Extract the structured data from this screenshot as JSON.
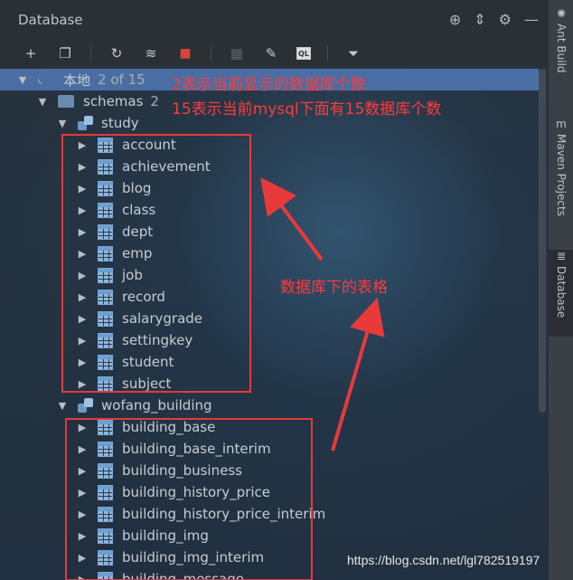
{
  "panel": {
    "title": "Database"
  },
  "title_tools": [
    "globe-icon",
    "collapse-icon",
    "gear-icon",
    "minimize-icon"
  ],
  "toolbar": [
    "add",
    "copy",
    "refresh",
    "edit-schema",
    "stop",
    "table",
    "pencil",
    "console",
    "filter"
  ],
  "tree": {
    "root": {
      "label": "本地",
      "count": "2 of 15"
    },
    "schemas": {
      "label": "schemas",
      "count": "2"
    },
    "study": {
      "label": "study",
      "tables": [
        "account",
        "achievement",
        "blog",
        "class",
        "dept",
        "emp",
        "job",
        "record",
        "salarygrade",
        "settingkey",
        "student",
        "subject"
      ]
    },
    "wofang": {
      "label": "wofang_building",
      "tables": [
        "building_base",
        "building_base_interim",
        "building_business",
        "building_history_price",
        "building_history_price_interim",
        "building_img",
        "building_img_interim",
        "building_message"
      ]
    }
  },
  "annotations": {
    "note1": "2表示当前显示的数据库个数",
    "note2": "15表示当前mysql下面有15数据库个数",
    "note3": "数据库下的表格"
  },
  "sidebar": {
    "tabs": [
      {
        "label": "Ant Build",
        "icon": "ant-icon"
      },
      {
        "label": "Maven Projects",
        "icon": "maven-icon"
      },
      {
        "label": "Database",
        "icon": "database-icon"
      }
    ]
  },
  "watermark": "https://blog.csdn.net/lgl782519197",
  "colors": {
    "annotation": "#e8393b",
    "selection": "#4a6ea3"
  }
}
